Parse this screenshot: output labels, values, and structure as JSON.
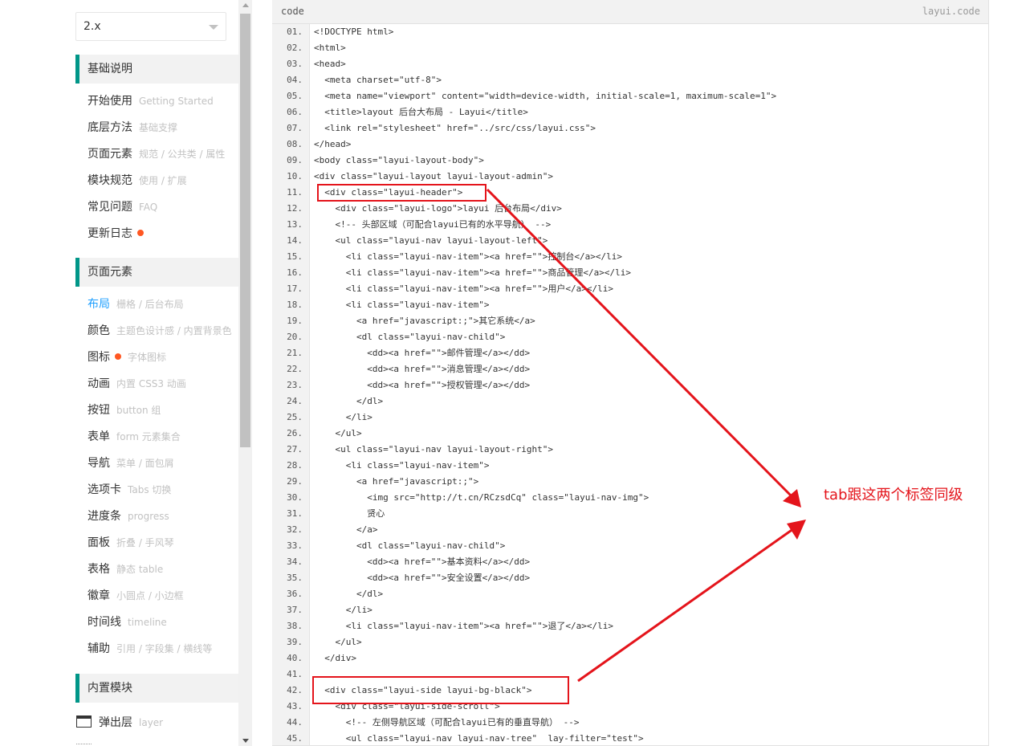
{
  "version_select": {
    "value": "2.x"
  },
  "sections": [
    {
      "title": "基础说明",
      "items": [
        {
          "label": "开始使用",
          "sub": "Getting Started"
        },
        {
          "label": "底层方法",
          "sub": "基础支撑"
        },
        {
          "label": "页面元素",
          "sub": "规范 / 公共类 / 属性"
        },
        {
          "label": "模块规范",
          "sub": "使用 / 扩展"
        },
        {
          "label": "常见问题",
          "sub": "FAQ"
        },
        {
          "label": "更新日志",
          "sub": ""
        }
      ]
    },
    {
      "title": "页面元素",
      "items": [
        {
          "label": "布局",
          "sub": "栅格 / 后台布局"
        },
        {
          "label": "颜色",
          "sub": "主题色设计感 / 内置背景色"
        },
        {
          "label": "图标",
          "sub": "字体图标"
        },
        {
          "label": "动画",
          "sub": "内置 CSS3 动画"
        },
        {
          "label": "按钮",
          "sub": "button 组"
        },
        {
          "label": "表单",
          "sub": "form 元素集合"
        },
        {
          "label": "导航",
          "sub": "菜单 / 面包屑"
        },
        {
          "label": "选项卡",
          "sub": "Tabs 切换"
        },
        {
          "label": "进度条",
          "sub": "progress"
        },
        {
          "label": "面板",
          "sub": "折叠 / 手风琴"
        },
        {
          "label": "表格",
          "sub": "静态 table"
        },
        {
          "label": "徽章",
          "sub": "小圆点 / 小边框"
        },
        {
          "label": "时间线",
          "sub": "timeline"
        },
        {
          "label": "辅助",
          "sub": "引用 / 字段集 / 横线等"
        }
      ]
    },
    {
      "title": "内置模块",
      "items": [
        {
          "label": "弹出层",
          "sub": "layer"
        }
      ]
    }
  ],
  "code_panel": {
    "header_left": "code",
    "header_right": "layui.code",
    "line_numbers": [
      "01.",
      "02.",
      "03.",
      "04.",
      "05.",
      "06.",
      "07.",
      "08.",
      "09.",
      "10.",
      "11.",
      "12.",
      "13.",
      "14.",
      "15.",
      "16.",
      "17.",
      "18.",
      "19.",
      "20.",
      "21.",
      "22.",
      "23.",
      "24.",
      "25.",
      "26.",
      "27.",
      "28.",
      "29.",
      "30.",
      "31.",
      "32.",
      "33.",
      "34.",
      "35.",
      "36.",
      "37.",
      "38.",
      "39.",
      "40.",
      "41.",
      "42.",
      "43.",
      "44.",
      "45."
    ],
    "lines": [
      "<!DOCTYPE html>",
      "<html>",
      "<head>",
      "  <meta charset=\"utf-8\">",
      "  <meta name=\"viewport\" content=\"width=device-width, initial-scale=1, maximum-scale=1\">",
      "  <title>layout 后台大布局 - Layui</title>",
      "  <link rel=\"stylesheet\" href=\"../src/css/layui.css\">",
      "</head>",
      "<body class=\"layui-layout-body\">",
      "<div class=\"layui-layout layui-layout-admin\">",
      "  <div class=\"layui-header\">",
      "    <div class=\"layui-logo\">layui 后台布局</div>",
      "    <!-- 头部区域（可配合layui已有的水平导航） -->",
      "    <ul class=\"layui-nav layui-layout-left\">",
      "      <li class=\"layui-nav-item\"><a href=\"\">控制台</a></li>",
      "      <li class=\"layui-nav-item\"><a href=\"\">商品管理</a></li>",
      "      <li class=\"layui-nav-item\"><a href=\"\">用户</a></li>",
      "      <li class=\"layui-nav-item\">",
      "        <a href=\"javascript:;\">其它系统</a>",
      "        <dl class=\"layui-nav-child\">",
      "          <dd><a href=\"\">邮件管理</a></dd>",
      "          <dd><a href=\"\">消息管理</a></dd>",
      "          <dd><a href=\"\">授权管理</a></dd>",
      "        </dl>",
      "      </li>",
      "    </ul>",
      "    <ul class=\"layui-nav layui-layout-right\">",
      "      <li class=\"layui-nav-item\">",
      "        <a href=\"javascript:;\">",
      "          <img src=\"http://t.cn/RCzsdCq\" class=\"layui-nav-img\">",
      "          贤心",
      "        </a>",
      "        <dl class=\"layui-nav-child\">",
      "          <dd><a href=\"\">基本资料</a></dd>",
      "          <dd><a href=\"\">安全设置</a></dd>",
      "        </dl>",
      "      </li>",
      "      <li class=\"layui-nav-item\"><a href=\"\">退了</a></li>",
      "    </ul>",
      "  </div>",
      "",
      "  <div class=\"layui-side layui-bg-black\">",
      "    <div class=\"layui-side-scroll\">",
      "      <!-- 左侧导航区域（可配合layui已有的垂直导航） -->",
      "      <ul class=\"layui-nav layui-nav-tree\"  lay-filter=\"test\">"
    ]
  },
  "annotation": {
    "text": "tab跟这两个标签同级"
  },
  "colors": {
    "accent": "#009688",
    "active_link": "#1e9fff",
    "badge_dot": "#ff5722",
    "annotation_red": "#e4141b"
  }
}
